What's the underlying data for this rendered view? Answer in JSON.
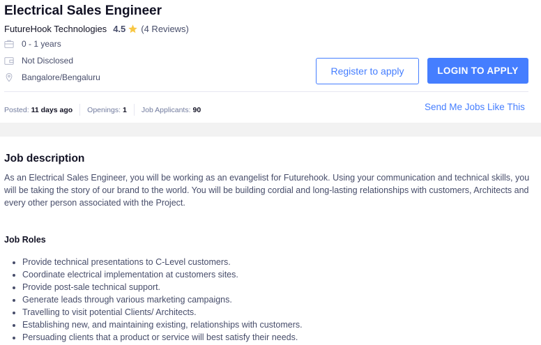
{
  "job": {
    "title": "Electrical Sales Engineer",
    "company": "FutureHook Technologies",
    "rating": "4.5",
    "reviews": "(4 Reviews)",
    "experience": "0 - 1 years",
    "salary": "Not Disclosed",
    "location": "Bangalore/Bengaluru"
  },
  "actions": {
    "register_label": "Register to apply",
    "login_label": "LOGIN TO APPLY",
    "send_jobs_label": "Send Me Jobs Like This"
  },
  "stats": {
    "posted_label": "Posted:",
    "posted_value": "11 days ago",
    "openings_label": "Openings:",
    "openings_value": "1",
    "applicants_label": "Job Applicants:",
    "applicants_value": "90"
  },
  "description": {
    "heading": "Job description",
    "body": "As an Electrical Sales Engineer, you will be working as an evangelist for Futurehook. Using your communication and technical skills, you will be taking the story of our brand to the world. You will be building cordial and long-lasting relationships with customers, Architects and every other person associated with the Project.",
    "roles_heading": "Job Roles",
    "roles": [
      "Provide technical presentations to C-Level customers.",
      "Coordinate electrical implementation at customers sites.",
      "Provide post-sale technical support.",
      "Generate leads through various marketing campaigns.",
      "Travelling to visit potential Clients/ Architects.",
      "Establishing new, and maintaining existing, relationships with customers.",
      "Persuading clients that a product or service will best satisfy their needs."
    ]
  },
  "icons": {
    "star": "star-icon",
    "experience": "briefcase-icon",
    "salary": "wallet-icon",
    "location": "location-pin-icon"
  },
  "colors": {
    "accent": "#457eff",
    "star": "#f8c744",
    "text_primary": "#121224",
    "text_secondary": "#474d6a"
  }
}
